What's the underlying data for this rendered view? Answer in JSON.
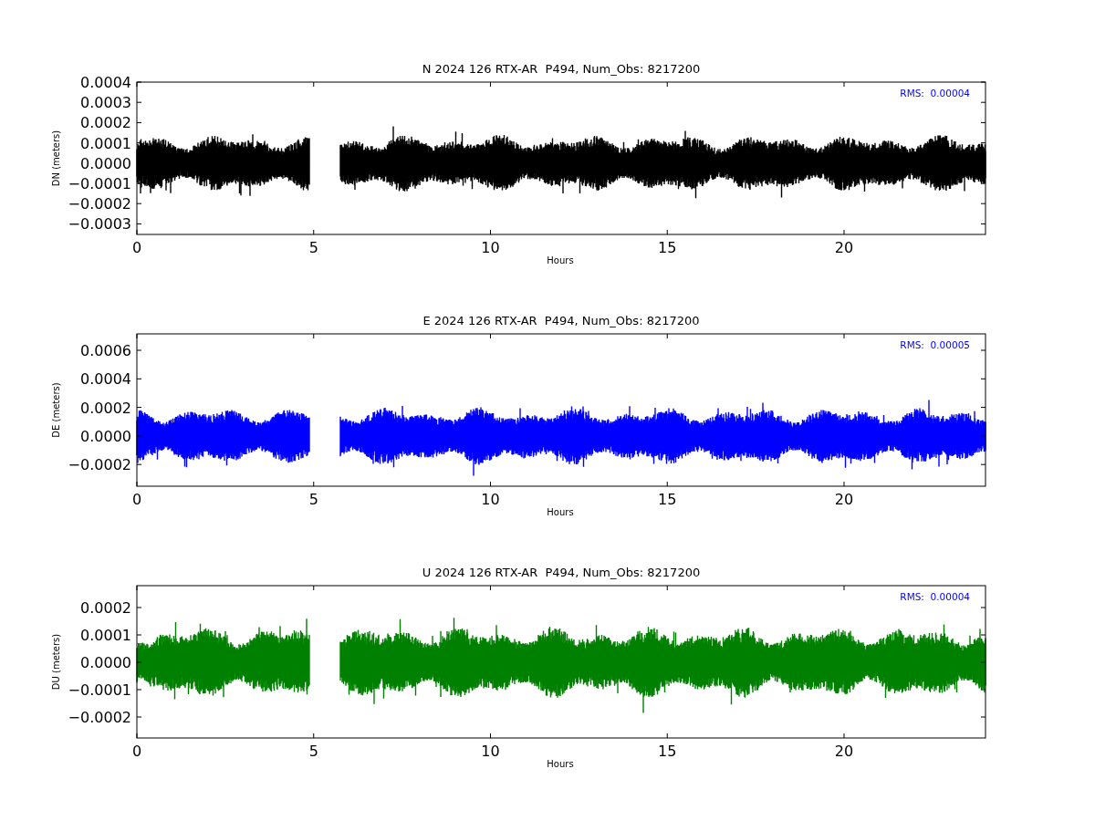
{
  "panels": [
    {
      "title": "N 2024 126 RTX-AR  P494, Num_Obs: 8217200",
      "ylabel": "DN (meters)",
      "xlabel": "Hours",
      "rms": "RMS:  0.00004",
      "color": "#000000",
      "yticks": [
        "0.0004",
        "0.0003",
        "0.0002",
        "0.0001",
        "0.0000",
        "−0.0001",
        "−0.0002",
        "−0.0003"
      ],
      "xticks": [
        "0",
        "5",
        "10",
        "15",
        "20"
      ]
    },
    {
      "title": "E 2024 126 RTX-AR  P494, Num_Obs: 8217200",
      "ylabel": "DE (meters)",
      "xlabel": "Hours",
      "rms": "RMS:  0.00005",
      "color": "#0000ff",
      "yticks": [
        "0.0006",
        "0.0004",
        "0.0002",
        "0.0000",
        "−0.0002"
      ],
      "xticks": [
        "0",
        "5",
        "10",
        "15",
        "20"
      ]
    },
    {
      "title": "U 2024 126 RTX-AR  P494, Num_Obs: 8217200",
      "ylabel": "DU (meters)",
      "xlabel": "Hours",
      "rms": "RMS:  0.00004",
      "color": "#008000",
      "yticks": [
        "0.0002",
        "0.0001",
        "0.0000",
        "−0.0001",
        "−0.0002"
      ],
      "xticks": [
        "0",
        "5",
        "10",
        "15",
        "20"
      ]
    }
  ]
}
